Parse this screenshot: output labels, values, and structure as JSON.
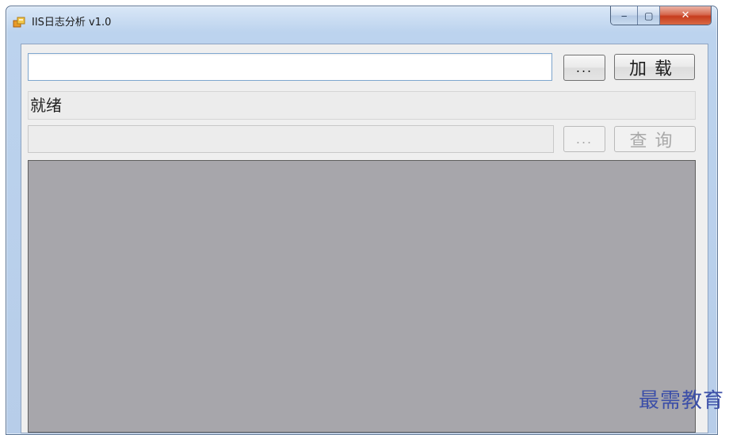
{
  "window": {
    "title": "IIS日志分析 v1.0",
    "minimize_glyph": "‒",
    "maximize_glyph": "▢",
    "close_glyph": "✕"
  },
  "form": {
    "path_value": "",
    "browse_label": "...",
    "load_label": "加载",
    "status_text": "就绪",
    "query_value": "",
    "query_browse_label": "...",
    "query_label": "查询"
  },
  "watermark": "最需教育",
  "colors": {
    "window_frame": "#b7cde9",
    "client_bg": "#efefef",
    "grid_bg": "#a7a6ab",
    "close_button": "#c63c1e",
    "watermark": "#3c4fa8"
  }
}
